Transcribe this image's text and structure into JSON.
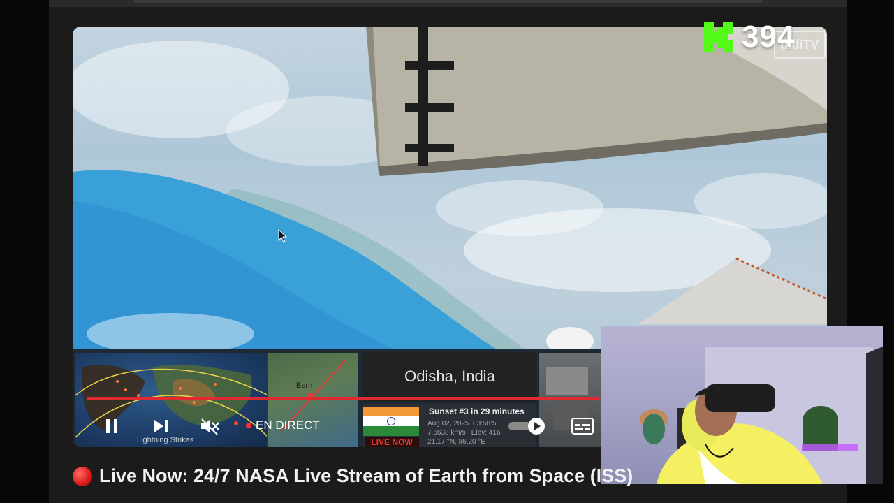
{
  "kick_overlay": {
    "logo_letter": "K",
    "viewer_count": "394",
    "watermark": "didiTV"
  },
  "player": {
    "location_label": "Odisha, India",
    "sunset_text": "Sunset #3 in 29 minutes",
    "telemetry_line1": "Aug 02, 2025  03:58:5",
    "telemetry_line2": "7.6638 km/s   Elev: 416",
    "telemetry_line3": "21.17 °N, 86.20 °E",
    "live_now_badge": "LIVE NOW",
    "map_caption": "Lightning Strikes",
    "map_city_label": "Berh",
    "live_label": "EN DIRECT",
    "controls": {
      "play_state": "playing",
      "muted": true
    }
  },
  "video_title": "Live Now: 24/7 NASA Live Stream of Earth from Space (ISS)",
  "colors": {
    "progress": "#e02930",
    "kick_green": "#53fc18",
    "live_red": "#ff2d2d"
  }
}
